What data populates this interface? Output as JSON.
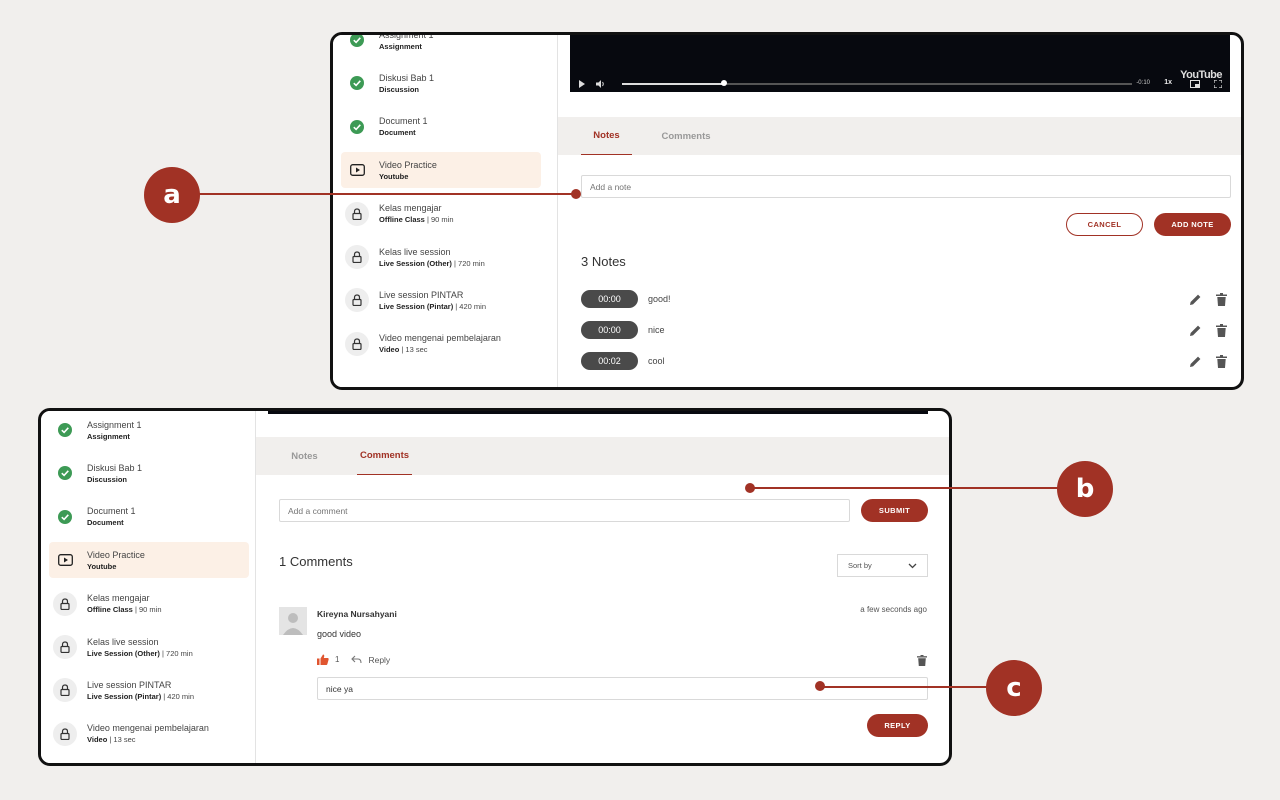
{
  "colors": {
    "accent": "#a13225",
    "done": "#3d9a55",
    "background": "#f1efed"
  },
  "sidebar": {
    "items": [
      {
        "title": "Assignment 1",
        "type": "Assignment",
        "extra": "",
        "status": "done",
        "icon": "check-circle-icon"
      },
      {
        "title": "Diskusi Bab 1",
        "type": "Discussion",
        "extra": "",
        "status": "done",
        "icon": "check-circle-icon"
      },
      {
        "title": "Document 1",
        "type": "Document",
        "extra": "",
        "status": "done",
        "icon": "check-circle-icon"
      },
      {
        "title": "Video Practice",
        "type": "Youtube",
        "extra": "",
        "status": "active",
        "icon": "play-icon"
      },
      {
        "title": "Kelas mengajar",
        "type": "Offline Class",
        "extra": " | 90 min",
        "status": "locked",
        "icon": "lock-icon"
      },
      {
        "title": "Kelas live session",
        "type": "Live Session (Other)",
        "extra": " | 720 min",
        "status": "locked",
        "icon": "lock-icon"
      },
      {
        "title": "Live session PINTAR",
        "type": "Live Session (Pintar)",
        "extra": " | 420 min",
        "status": "locked",
        "icon": "lock-icon"
      },
      {
        "title": "Video mengenai pembelajaran",
        "type": "Video",
        "extra": " | 13 sec",
        "status": "locked",
        "icon": "lock-icon"
      }
    ]
  },
  "video": {
    "time_left": "-0:10",
    "speed": "1x",
    "brand": "YouTube",
    "progress": 0.2
  },
  "tabs": {
    "notes": "Notes",
    "comments": "Comments"
  },
  "notes_panel": {
    "placeholder": "Add a note",
    "cancel_label": "CANCEL",
    "add_label": "ADD NOTE",
    "count_label": "3 Notes",
    "notes": [
      {
        "time": "00:00",
        "text": "good!"
      },
      {
        "time": "00:00",
        "text": "nice"
      },
      {
        "time": "00:02",
        "text": "cool"
      }
    ]
  },
  "comments_panel": {
    "placeholder": "Add a comment",
    "submit_label": "SUBMIT",
    "count_label": "1 Comments",
    "sort_label": "Sort by",
    "comment": {
      "author": "Kireyna Nursahyani",
      "time": "a few seconds ago",
      "text": "good video",
      "likes": "1",
      "reply_label": "Reply"
    },
    "reply_value": "nice ya",
    "reply_button": "REPLY"
  },
  "callouts": {
    "a": "a",
    "b": "b",
    "c": "c"
  }
}
